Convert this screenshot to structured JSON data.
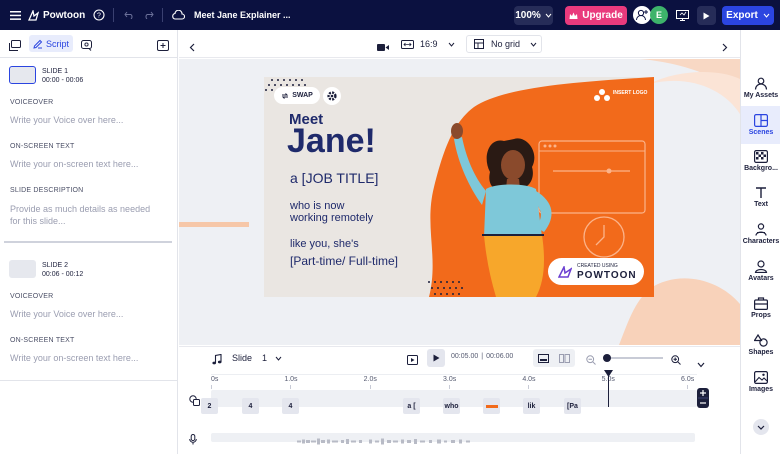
{
  "app": {
    "brand": "Powtoon",
    "project_title": "Meet Jane Explainer ...",
    "zoom": "100%",
    "upgrade_label": "Upgrade",
    "avatar_initial": "E",
    "export_label": "Export"
  },
  "left_panel": {
    "tab_script": "Script",
    "slides": [
      {
        "title": "SLIDE 1",
        "time": "00:00 - 00:06",
        "voiceover_label": "VOICEOVER",
        "voiceover_placeholder": "Write your Voice over here...",
        "onscreen_label": "ON-SCREEN TEXT",
        "onscreen_placeholder": "Write your on-screen text here...",
        "description_label": "SLIDE DESCRIPTION",
        "description_placeholder": "Provide as much details as needed for this slide..."
      },
      {
        "title": "SLIDE 2",
        "time": "00:06 - 00:12",
        "voiceover_label": "VOICEOVER",
        "voiceover_placeholder": "Write your Voice over here...",
        "onscreen_label": "ON-SCREEN TEXT",
        "onscreen_placeholder": "Write your on-screen text here..."
      }
    ]
  },
  "canvas_toolbar": {
    "aspect_ratio": "16:9",
    "grid": "No grid"
  },
  "slide_content": {
    "swap_label": "SWAP",
    "logo_text": "INSERT LOGO",
    "meet": "Meet",
    "name": "Jane!",
    "job_title": "a [JOB TITLE]",
    "line1": "who is now",
    "line2": "working remotely",
    "line3": "like you, she's",
    "line4": "[Part-time/ Full-time]",
    "badge_small": "CREATED USING",
    "badge_big": "POWTOON"
  },
  "right_toolbar": {
    "items": [
      "My Assets",
      "Scenes",
      "Backgro...",
      "Text",
      "Characters",
      "Avatars",
      "Props",
      "Shapes",
      "Images"
    ]
  },
  "timeline": {
    "slide_label": "Slide",
    "slide_number": "1",
    "current_time": "00:05.00",
    "total_time": "00:06.00",
    "progress": 0.833,
    "ticks": [
      "0s",
      "1.0s",
      "2.0s",
      "3.0s",
      "4.0s",
      "5.0s",
      "6.0s"
    ],
    "chips": [
      "2",
      "4",
      "4",
      "a [",
      "who",
      "",
      "lik",
      "[Pa"
    ]
  },
  "colors": {
    "topbar": "#0b1140",
    "upgrade": "#e93a7d",
    "export": "#2b45e0",
    "accent": "#2b45e0",
    "orange": "#f26a1b"
  }
}
